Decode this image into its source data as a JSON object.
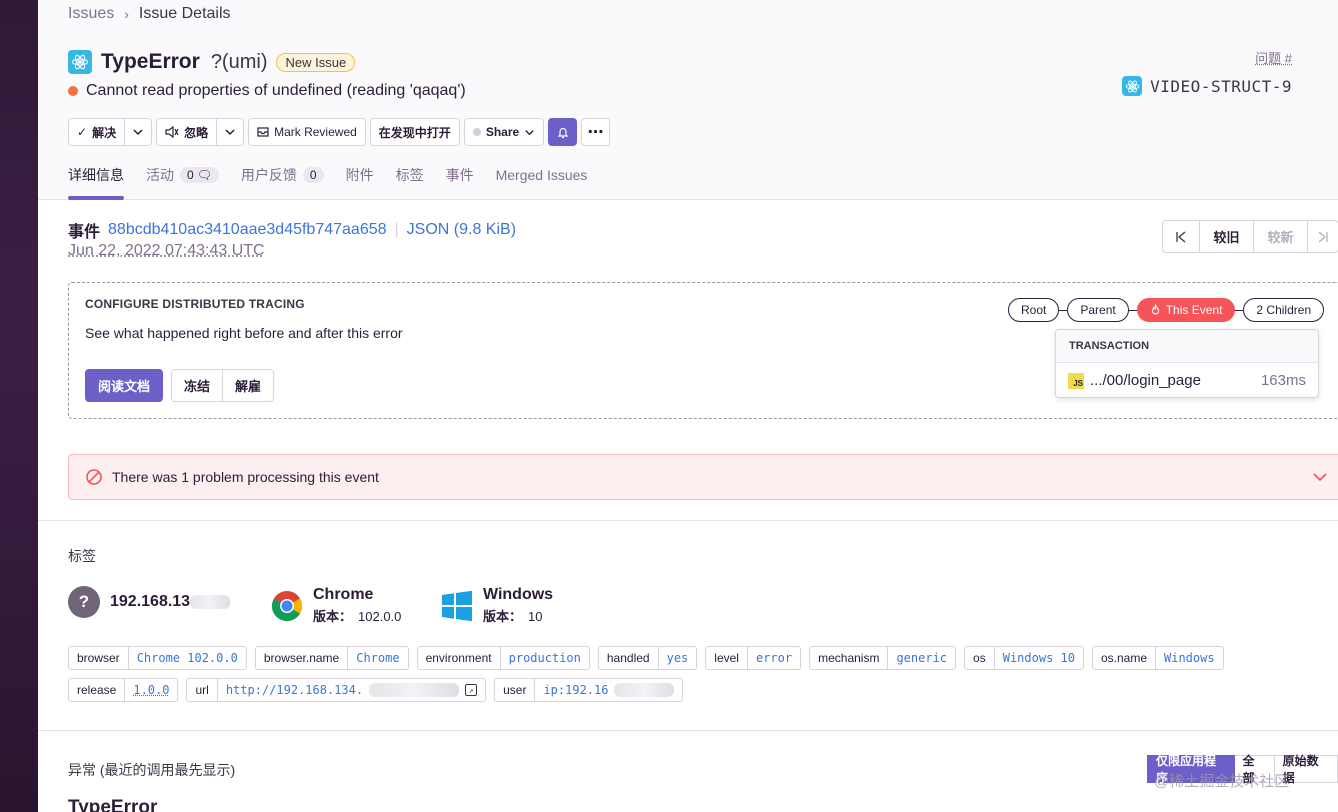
{
  "breadcrumb": {
    "root": "Issues",
    "current": "Issue Details"
  },
  "issue": {
    "type": "TypeError",
    "culprit": "?(umi)",
    "badge": "New Issue",
    "message": "Cannot read properties of undefined (reading 'qaqaq')",
    "id_label": "问题 #",
    "short_id": "VIDEO-STRUCT-9"
  },
  "actions": {
    "resolve": "解决",
    "ignore": "忽略",
    "mark_reviewed": "Mark Reviewed",
    "open_in_discover": "在发现中打开",
    "share": "Share"
  },
  "tabs": [
    {
      "label": "详细信息"
    },
    {
      "label": "活动",
      "count": "0"
    },
    {
      "label": "用户反馈",
      "count": "0"
    },
    {
      "label": "附件"
    },
    {
      "label": "标签"
    },
    {
      "label": "事件"
    },
    {
      "label": "Merged Issues"
    }
  ],
  "event": {
    "label": "事件",
    "hash": "88bcdb410ac3410aae3d45fb747aa658",
    "json": "JSON (9.8 KiB)",
    "date": "Jun 22, 2022 07:43:43 UTC"
  },
  "pager": {
    "older": "较旧",
    "newer": "较新"
  },
  "tracing": {
    "title": "CONFIGURE DISTRIBUTED TRACING",
    "description": "See what happened right before and after this error",
    "read_docs": "阅读文档",
    "snooze": "冻结",
    "dismiss": "解雇",
    "chain": {
      "root": "Root",
      "parent": "Parent",
      "current": "This Event",
      "children": "2 Children"
    },
    "transaction_header": "TRANSACTION",
    "transaction_name": ".../00/login_page",
    "transaction_time": "163ms",
    "js_badge": "JS"
  },
  "alert": {
    "text": "There was 1 problem processing this event"
  },
  "tags_section": {
    "title": "标签",
    "contexts": [
      {
        "title": "192.168.13",
        "sub_label": "",
        "sub_value": ""
      },
      {
        "title": "Chrome",
        "sub_label": "版本：",
        "sub_value": "102.0.0"
      },
      {
        "title": "Windows",
        "sub_label": "版本：",
        "sub_value": "10"
      }
    ],
    "tags": [
      {
        "key": "browser",
        "value": "Chrome 102.0.0"
      },
      {
        "key": "browser.name",
        "value": "Chrome"
      },
      {
        "key": "environment",
        "value": "production"
      },
      {
        "key": "handled",
        "value": "yes"
      },
      {
        "key": "level",
        "value": "error"
      },
      {
        "key": "mechanism",
        "value": "generic"
      },
      {
        "key": "os",
        "value": "Windows 10"
      },
      {
        "key": "os.name",
        "value": "Windows"
      },
      {
        "key": "release",
        "value": "1.0.0"
      },
      {
        "key": "url",
        "value": "http://192.168.134."
      },
      {
        "key": "user",
        "value": "ip:192.16"
      }
    ]
  },
  "exception": {
    "title": "异常 (最近的调用最先显示)",
    "toggle": {
      "app_only": "仅限应用程序",
      "full": "全部",
      "raw": "原始数据"
    },
    "type": "TypeError"
  },
  "watermark": "@稀土掘金技术社区",
  "colors": {
    "accent": "#6c5fc7",
    "link": "#3d74db",
    "alert_bg": "#fdeef0",
    "current_event": "#f55459"
  }
}
